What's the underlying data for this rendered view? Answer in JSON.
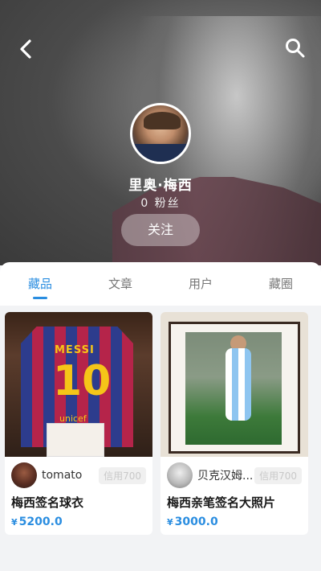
{
  "profile": {
    "name": "里奥·梅西",
    "fans": "0  粉丝",
    "follow_label": "关注"
  },
  "tabs": [
    {
      "label": "藏品",
      "active": true
    },
    {
      "label": "文章",
      "active": false
    },
    {
      "label": "用户",
      "active": false
    },
    {
      "label": "藏圈",
      "active": false
    }
  ],
  "items": [
    {
      "user": "tomato",
      "credit": "信用700",
      "title": "梅西签名球衣",
      "currency": "¥",
      "price": "5200.0",
      "image_text": {
        "jersey_name": "MESSI",
        "jersey_number": "10",
        "sponsor": "unicef"
      }
    },
    {
      "user": "贝克汉姆...",
      "credit": "信用700",
      "title": "梅西亲笔签名大照片",
      "currency": "¥",
      "price": "3000.0"
    }
  ],
  "colors": {
    "accent": "#2a8de0"
  },
  "icons": {
    "back": "chevron-left-icon",
    "search": "search-icon"
  }
}
